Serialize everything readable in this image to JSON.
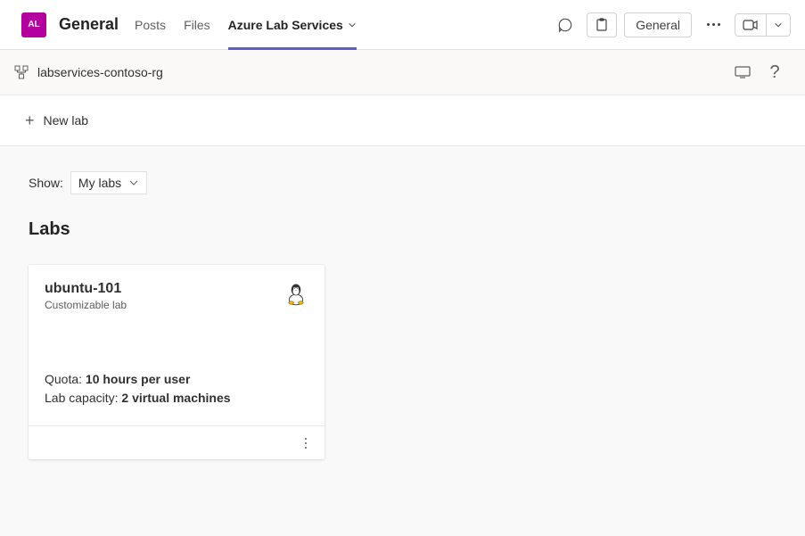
{
  "header": {
    "app_initials": "AL",
    "channel": "General",
    "tabs": {
      "posts": "Posts",
      "files": "Files",
      "azure": "Azure Lab Services"
    },
    "general_button": "General"
  },
  "subheader": {
    "resource_group": "labservices-contoso-rg"
  },
  "toolbar": {
    "new_lab": "New lab"
  },
  "filter": {
    "label": "Show:",
    "value": "My labs"
  },
  "section": {
    "title": "Labs"
  },
  "labs": [
    {
      "name": "ubuntu-101",
      "subtitle": "Customizable lab",
      "quota_label": "Quota: ",
      "quota_value": "10 hours per user",
      "capacity_label": "Lab capacity: ",
      "capacity_value": "2 virtual machines"
    }
  ]
}
